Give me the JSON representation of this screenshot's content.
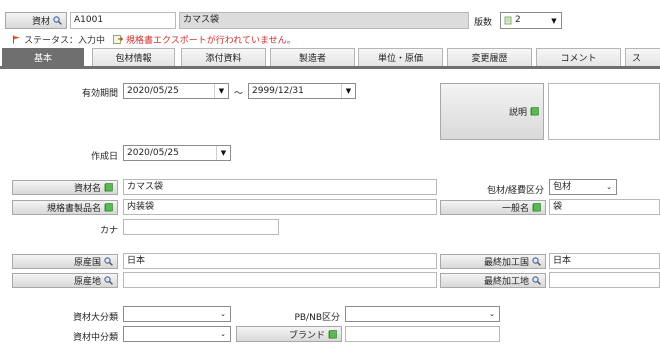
{
  "header": {
    "material_label": "資材",
    "material_code": "A1001",
    "material_name": "カマス袋",
    "version_label": "版数",
    "version_value": "2"
  },
  "status": {
    "status_text": "ステータス：入力中",
    "export_warning": "規格書エクスポートが行われていません。"
  },
  "tabs": [
    {
      "label": "基本",
      "active": true
    },
    {
      "label": "包材情報"
    },
    {
      "label": "添付資料"
    },
    {
      "label": "製造者"
    },
    {
      "label": "単位・原価"
    },
    {
      "label": "変更履歴"
    },
    {
      "label": "コメント"
    },
    {
      "label": "ス"
    }
  ],
  "form": {
    "validity_label": "有効期間",
    "validity_from": "2020/05/25",
    "validity_tilde": "～",
    "validity_to": "2999/12/31",
    "description_label": "説明",
    "created_label": "作成日",
    "created_date": "2020/05/25",
    "material_name_label": "資材名",
    "material_name_value": "カマス袋",
    "spec_product_label": "規格書製品名",
    "spec_product_value": "内装袋",
    "kana_label": "カナ",
    "packaging_category_label": "包材/経費区分",
    "packaging_category_value": "包材",
    "general_name_label": "一般名",
    "general_name_value": "袋",
    "origin_country_label": "原産国",
    "origin_country_value": "日本",
    "origin_place_label": "原産地",
    "final_country_label": "最終加工国",
    "final_country_value": "日本",
    "final_place_label": "最終加工地",
    "major_class_label": "資材大分類",
    "middle_class_label": "資材中分類",
    "pbnb_label": "PB/NB区分",
    "brand_label": "ブランド"
  },
  "colors": {
    "tab_active": "#6f6f6f",
    "readonly_field": "#dcdcdc",
    "warning_text": "#d0312d",
    "book_icon": "#3f9b3a"
  }
}
